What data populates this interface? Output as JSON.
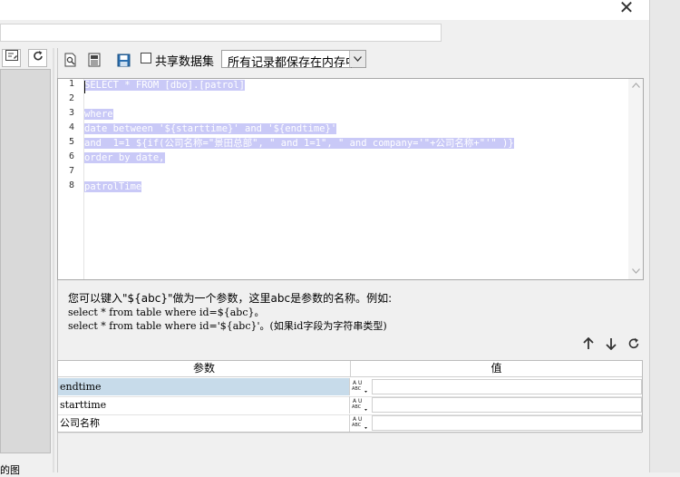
{
  "window": {
    "close_glyph": "✕"
  },
  "left_panel": {
    "caption": "的图"
  },
  "toolbar": {
    "share_dataset_label": "共享数据集",
    "storage_mode_value": "所有记录都保存在内存中",
    "icons": [
      "preview-icon",
      "properties-icon",
      "save-icon"
    ]
  },
  "editor": {
    "line_numbers": [
      "1",
      "2",
      "3",
      "4",
      "5",
      "6",
      "7",
      "8"
    ],
    "lines": [
      "SELECT * FROM [dbo].[patrol]",
      "",
      "where",
      "date between '${starttime}' and '${endtime}'",
      "and  1=1 ${if(公司名称=\"景田总部\", \" and 1=1\", \" and company='\"+公司名称+\"'\" )}",
      "order by date,",
      "",
      "patrolTime"
    ]
  },
  "hint": {
    "line1": "您可以键入\"${abc}\"做为一个参数，这里abc是参数的名称。例如:",
    "line2": "select * from table where id=${abc}。",
    "line3": "select * from table where id='${abc}'。(如果id字段为字符串类型)"
  },
  "params": {
    "header_name": "参数",
    "header_value": "值",
    "type_glyph": "ABC",
    "rows": [
      {
        "name": "endtime",
        "value": ""
      },
      {
        "name": "starttime",
        "value": ""
      },
      {
        "name": "公司名称",
        "value": ""
      }
    ]
  },
  "colors": {
    "selection": "#c9c9f7",
    "row_selected": "#c7dbea",
    "panel_bg": "#f0f0f0"
  }
}
